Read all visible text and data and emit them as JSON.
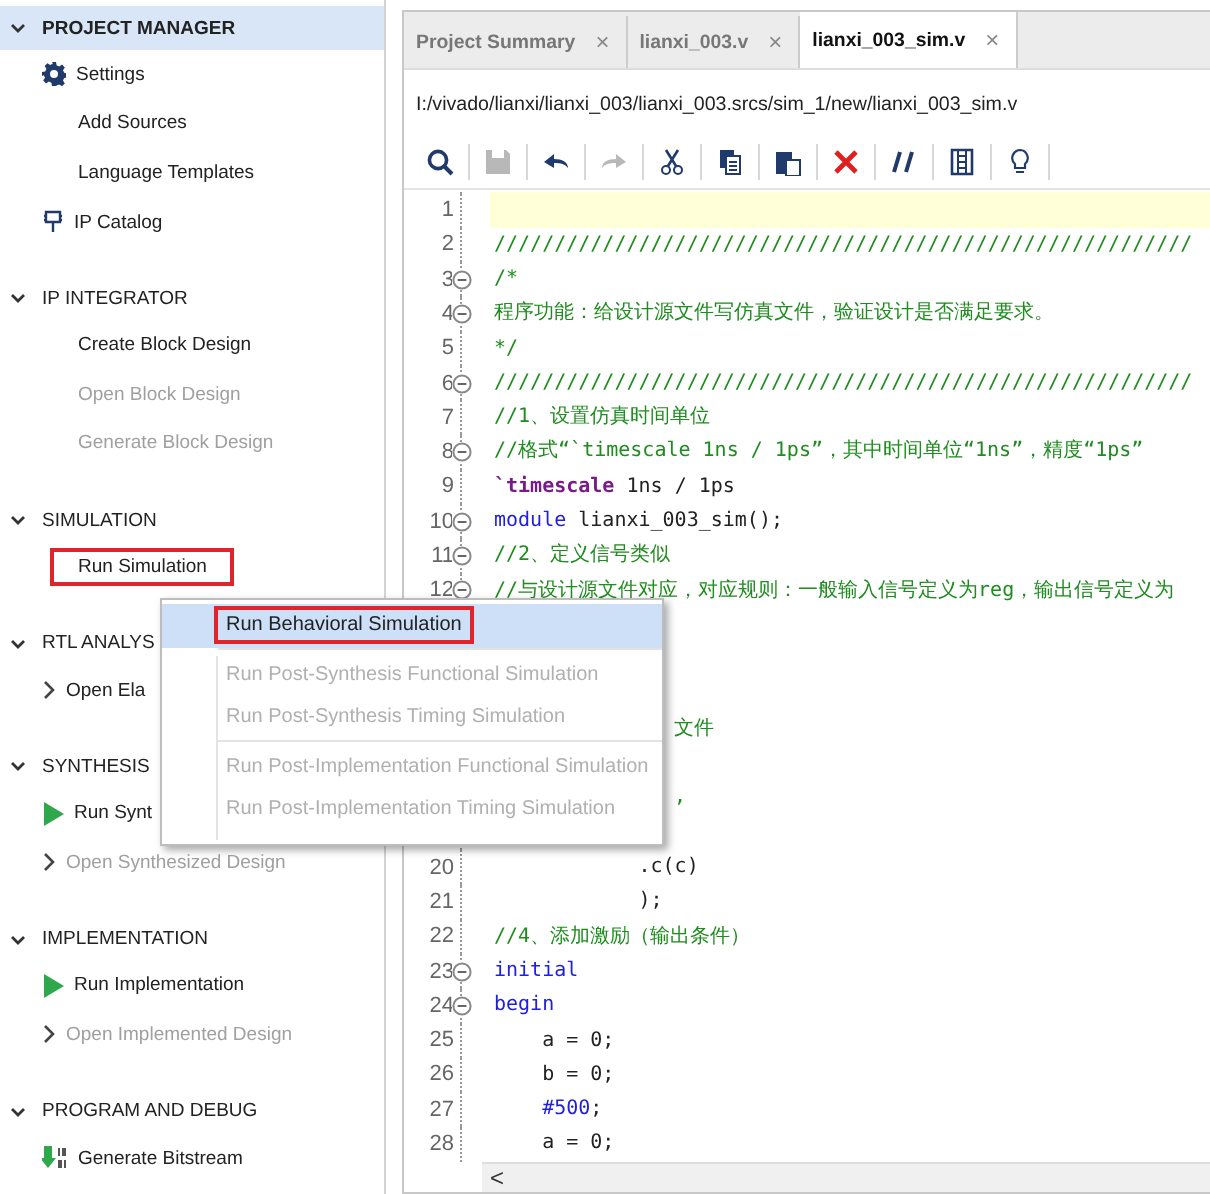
{
  "sidebar": {
    "sections": [
      {
        "title": "PROJECT MANAGER",
        "selected": true,
        "expanded": true,
        "items": [
          {
            "label": "Settings",
            "kind": "gear",
            "disabled": false,
            "outlined": false
          },
          {
            "label": "Add Sources",
            "kind": "plain",
            "disabled": false,
            "outlined": false
          },
          {
            "label": "Language Templates",
            "kind": "plain",
            "disabled": false,
            "outlined": false
          },
          {
            "label": "IP Catalog",
            "kind": "ip",
            "disabled": false,
            "outlined": false
          }
        ]
      },
      {
        "title": "IP INTEGRATOR",
        "selected": false,
        "expanded": true,
        "items": [
          {
            "label": "Create Block Design",
            "kind": "plain",
            "disabled": false,
            "outlined": false
          },
          {
            "label": "Open Block Design",
            "kind": "plain",
            "disabled": true,
            "outlined": false
          },
          {
            "label": "Generate Block Design",
            "kind": "plain",
            "disabled": true,
            "outlined": false
          }
        ]
      },
      {
        "title": "SIMULATION",
        "selected": false,
        "expanded": true,
        "items": [
          {
            "label": "Run Simulation",
            "kind": "plain",
            "disabled": false,
            "outlined": true
          }
        ]
      },
      {
        "title": "RTL ANALYS",
        "selected": false,
        "expanded": true,
        "items": [
          {
            "label": "Open Ela",
            "kind": "submenu",
            "disabled": false,
            "outlined": false
          }
        ]
      },
      {
        "title": "SYNTHESIS",
        "selected": false,
        "expanded": true,
        "items": [
          {
            "label": "Run Synt",
            "kind": "run",
            "disabled": false,
            "outlined": false
          },
          {
            "label": "Open Synthesized Design",
            "kind": "submenu",
            "disabled": true,
            "outlined": false
          }
        ]
      },
      {
        "title": "IMPLEMENTATION",
        "selected": false,
        "expanded": true,
        "items": [
          {
            "label": "Run Implementation",
            "kind": "run",
            "disabled": false,
            "outlined": false
          },
          {
            "label": "Open Implemented Design",
            "kind": "submenu",
            "disabled": true,
            "outlined": false
          }
        ]
      },
      {
        "title": "PROGRAM AND DEBUG",
        "selected": false,
        "expanded": true,
        "items": [
          {
            "label": "Generate Bitstream",
            "kind": "bitstream",
            "disabled": false,
            "outlined": false
          }
        ]
      }
    ]
  },
  "editor": {
    "tabs": [
      {
        "label": "Project Summary",
        "selected": false,
        "close": "×"
      },
      {
        "label": "lianxi_003.v",
        "selected": false,
        "close": "×"
      },
      {
        "label": "lianxi_003_sim.v",
        "selected": true,
        "close": "×"
      }
    ],
    "path": "I:/vivado/lianxi/lianxi_003/lianxi_003.srcs/sim_1/new/lianxi_003_sim.v",
    "toolbar": [
      {
        "kind": "search",
        "disabled": false
      },
      {
        "kind": "save",
        "disabled": true
      },
      {
        "kind": "undo",
        "disabled": false
      },
      {
        "kind": "redo",
        "disabled": true
      },
      {
        "kind": "cut",
        "disabled": false
      },
      {
        "kind": "copy",
        "disabled": false
      },
      {
        "kind": "paste",
        "disabled": false
      },
      {
        "kind": "delete",
        "disabled": false
      },
      {
        "kind": "comment",
        "disabled": false
      },
      {
        "kind": "columns",
        "disabled": false
      },
      {
        "kind": "hint",
        "disabled": false
      }
    ],
    "lines": [
      {
        "kind": "code",
        "number": "1",
        "fold": false,
        "current": true
      },
      {
        "kind": "code",
        "number": "2",
        "fold": false,
        "current": false,
        "segments": [
          {
            "kind": "comment",
            "text": "//////////////////////////////////////////////////////////"
          }
        ]
      },
      {
        "kind": "code",
        "number": "3",
        "fold": true,
        "current": false,
        "segments": [
          {
            "kind": "comment",
            "text": "/*"
          }
        ]
      },
      {
        "kind": "code",
        "number": "4",
        "fold": true,
        "current": false,
        "segments": [
          {
            "kind": "comment",
            "text": "程序功能：给设计源文件写仿真文件，验证设计是否满足要求。"
          }
        ]
      },
      {
        "kind": "code",
        "number": "5",
        "fold": false,
        "current": false,
        "segments": [
          {
            "kind": "comment",
            "text": "*/"
          }
        ]
      },
      {
        "kind": "code",
        "number": "6",
        "fold": true,
        "current": false,
        "segments": [
          {
            "kind": "comment",
            "text": "//////////////////////////////////////////////////////////"
          }
        ]
      },
      {
        "kind": "code",
        "number": "7",
        "fold": false,
        "current": false,
        "segments": [
          {
            "kind": "comment",
            "text": "//1、设置仿真时间单位"
          }
        ]
      },
      {
        "kind": "code",
        "number": "8",
        "fold": true,
        "current": false,
        "segments": [
          {
            "kind": "comment",
            "text": "//格式“`timescale 1ns / 1ps”，其中时间单位“1ns”，精度“1ps”"
          }
        ]
      },
      {
        "kind": "code",
        "number": "9",
        "fold": false,
        "current": false,
        "segments": [
          {
            "kind": "directive",
            "text": "`timescale"
          },
          {
            "kind": "plain",
            "text": " 1ns / 1ps"
          }
        ]
      },
      {
        "kind": "code",
        "number": "10",
        "fold": true,
        "current": false,
        "segments": [
          {
            "kind": "keyword",
            "text": "module"
          },
          {
            "kind": "plain",
            "text": " lianxi_003_sim();"
          }
        ]
      },
      {
        "kind": "code",
        "number": "11",
        "fold": true,
        "current": false,
        "segments": [
          {
            "kind": "comment",
            "text": "//2、定义信号类似"
          }
        ]
      },
      {
        "kind": "code",
        "number": "12",
        "fold": true,
        "current": false,
        "segments": [
          {
            "kind": "comment",
            "text": "//与设计源文件对应，对应规则：一般输入信号定义为reg，输出信号定义为"
          }
        ]
      },
      {
        "kind": "covered"
      },
      {
        "kind": "covered"
      },
      {
        "kind": "covered"
      },
      {
        "kind": "covered",
        "fragment": "文件"
      },
      {
        "kind": "covered"
      },
      {
        "kind": "covered",
        "fragment": ","
      },
      {
        "kind": "covered"
      },
      {
        "kind": "code",
        "number": "20",
        "fold": false,
        "current": false,
        "segments": [
          {
            "kind": "plain",
            "text": "            .c(c)"
          }
        ]
      },
      {
        "kind": "code",
        "number": "21",
        "fold": false,
        "current": false,
        "segments": [
          {
            "kind": "plain",
            "text": "            );"
          }
        ]
      },
      {
        "kind": "code",
        "number": "22",
        "fold": false,
        "current": false,
        "segments": [
          {
            "kind": "comment",
            "text": "//4、添加激励（输出条件）"
          }
        ]
      },
      {
        "kind": "code",
        "number": "23",
        "fold": true,
        "current": false,
        "segments": [
          {
            "kind": "keyword",
            "text": "initial"
          }
        ]
      },
      {
        "kind": "code",
        "number": "24",
        "fold": true,
        "current": false,
        "segments": [
          {
            "kind": "keyword",
            "text": "begin"
          }
        ]
      },
      {
        "kind": "code",
        "number": "25",
        "fold": false,
        "current": false,
        "segments": [
          {
            "kind": "plain",
            "text": "    a = 0;"
          }
        ]
      },
      {
        "kind": "code",
        "number": "26",
        "fold": false,
        "current": false,
        "segments": [
          {
            "kind": "plain",
            "text": "    b = 0;"
          }
        ]
      },
      {
        "kind": "code",
        "number": "27",
        "fold": false,
        "current": false,
        "segments": [
          {
            "kind": "indent"
          },
          {
            "kind": "keyword",
            "text": "#500"
          },
          {
            "kind": "plain",
            "text": ";"
          }
        ]
      },
      {
        "kind": "code",
        "number": "28",
        "fold": false,
        "current": false,
        "segments": [
          {
            "kind": "plain",
            "text": "    a = 0;"
          }
        ]
      }
    ],
    "scroll_left": "<"
  },
  "context_menu": {
    "groups": [
      [
        {
          "label": "Run Behavioral Simulation",
          "selected": true,
          "disabled": false,
          "outlined": true
        }
      ],
      [
        {
          "label": "Run Post-Synthesis Functional Simulation",
          "selected": false,
          "disabled": true,
          "outlined": false
        },
        {
          "label": "Run Post-Synthesis Timing Simulation",
          "selected": false,
          "disabled": true,
          "outlined": false
        }
      ],
      [
        {
          "label": "Run Post-Implementation Functional Simulation",
          "selected": false,
          "disabled": true,
          "outlined": false
        },
        {
          "label": "Run Post-Implementation Timing Simulation",
          "selected": false,
          "disabled": true,
          "outlined": false
        }
      ]
    ]
  }
}
